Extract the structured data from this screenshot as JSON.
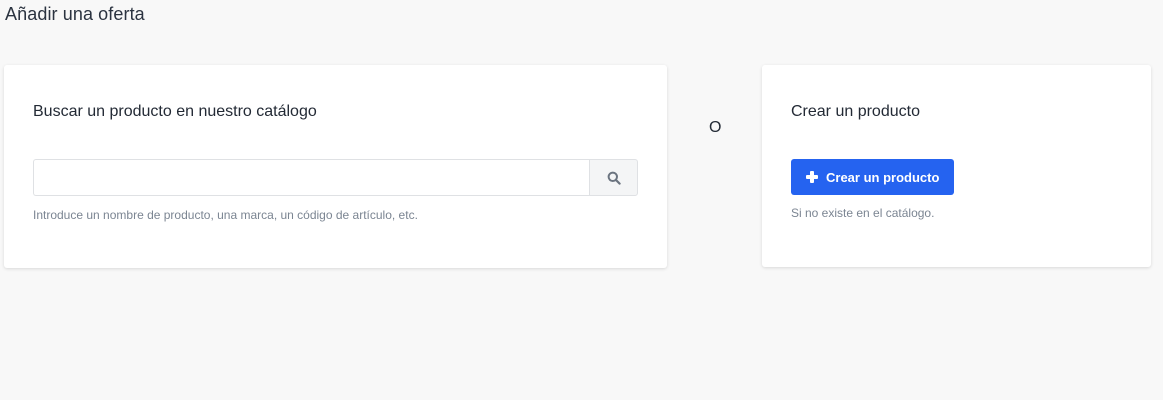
{
  "page": {
    "title": "Añadir una oferta"
  },
  "search_card": {
    "heading": "Buscar un producto en nuestro catálogo",
    "input_value": "",
    "input_placeholder": "",
    "button_icon": "search-icon",
    "hint": "Introduce un nombre de producto, una marca, un código de artículo, etc."
  },
  "separator": {
    "label": "O"
  },
  "create_card": {
    "heading": "Crear un producto",
    "button_label": "Crear un producto",
    "button_icon": "plus-icon",
    "hint": "Si no existe en el catálogo."
  },
  "colors": {
    "accent": "#2563f0",
    "background": "#f8f8f8",
    "hint_text": "#7b8592"
  }
}
